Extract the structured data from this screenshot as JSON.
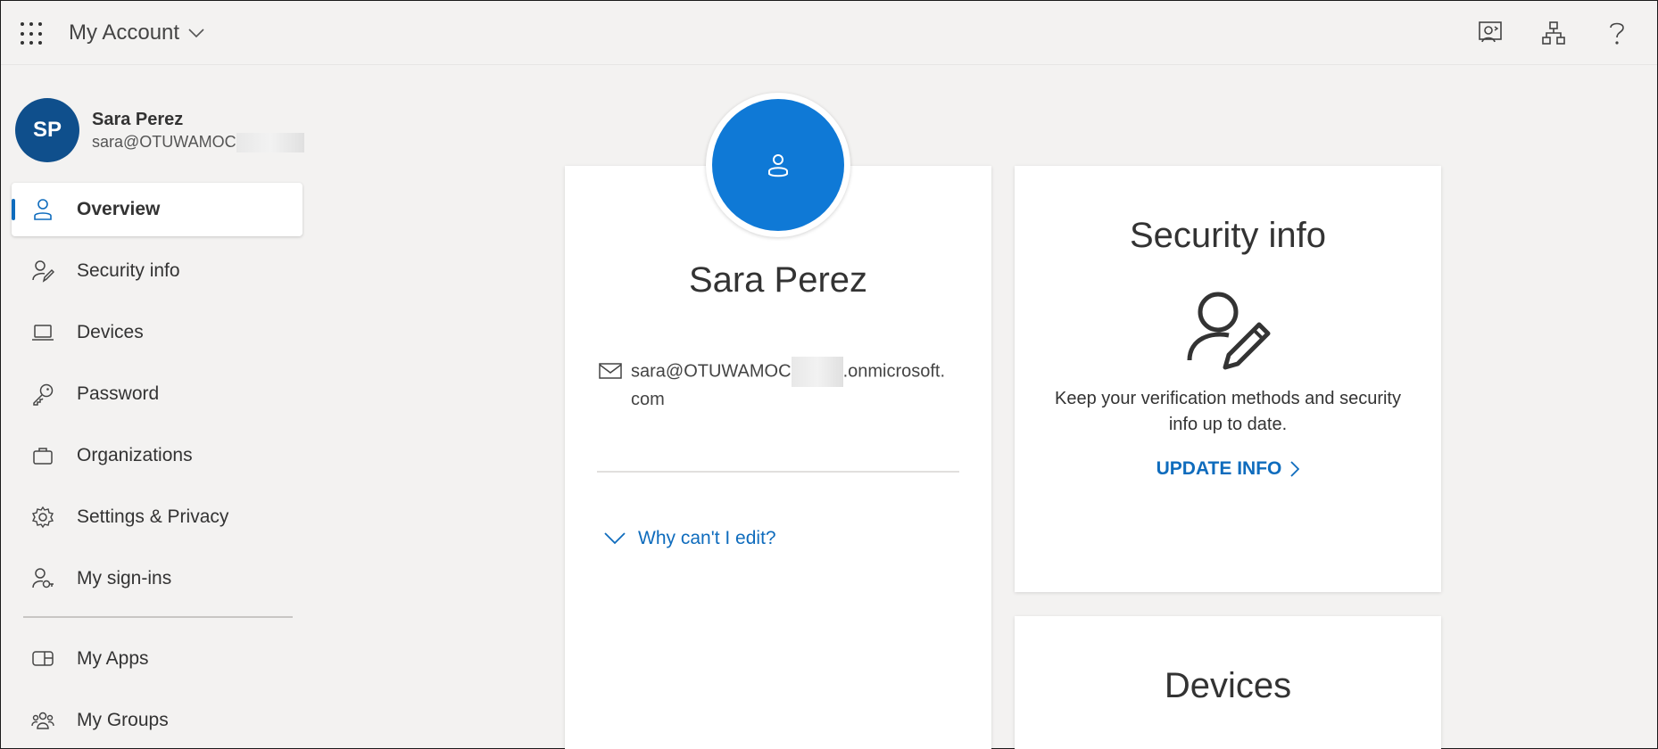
{
  "header": {
    "app_title": "My Account",
    "icons": [
      "feedback-icon",
      "organization-icon",
      "help-icon"
    ]
  },
  "sidebar": {
    "avatar_initials": "SP",
    "user_name": "Sara Perez",
    "user_email_prefix": "sara@OTUWAMOC",
    "items": [
      {
        "label": "Overview",
        "icon": "person-icon",
        "active": true
      },
      {
        "label": "Security info",
        "icon": "person-edit-icon",
        "active": false
      },
      {
        "label": "Devices",
        "icon": "laptop-icon",
        "active": false
      },
      {
        "label": "Password",
        "icon": "key-icon",
        "active": false
      },
      {
        "label": "Organizations",
        "icon": "briefcase-icon",
        "active": false
      },
      {
        "label": "Settings & Privacy",
        "icon": "gear-icon",
        "active": false
      },
      {
        "label": "My sign-ins",
        "icon": "person-key-icon",
        "active": false
      }
    ],
    "items_secondary": [
      {
        "label": "My Apps",
        "icon": "apps-icon"
      },
      {
        "label": "My Groups",
        "icon": "groups-icon"
      }
    ]
  },
  "profile_card": {
    "name": "Sara Perez",
    "email_prefix": "sara@OTUWAMOC",
    "email_suffix": ".onmicrosoft.",
    "email_line2": "com",
    "why_link": "Why can't I edit?"
  },
  "security_card": {
    "title": "Security info",
    "description": "Keep your verification methods and security info up to date.",
    "link": "UPDATE INFO"
  },
  "devices_card": {
    "title": "Devices"
  },
  "colors": {
    "accent": "#0f6cbd",
    "avatar_bg": "#0f4f8c",
    "photo_bg": "#0f79d6",
    "page_bg": "#f3f2f1"
  }
}
